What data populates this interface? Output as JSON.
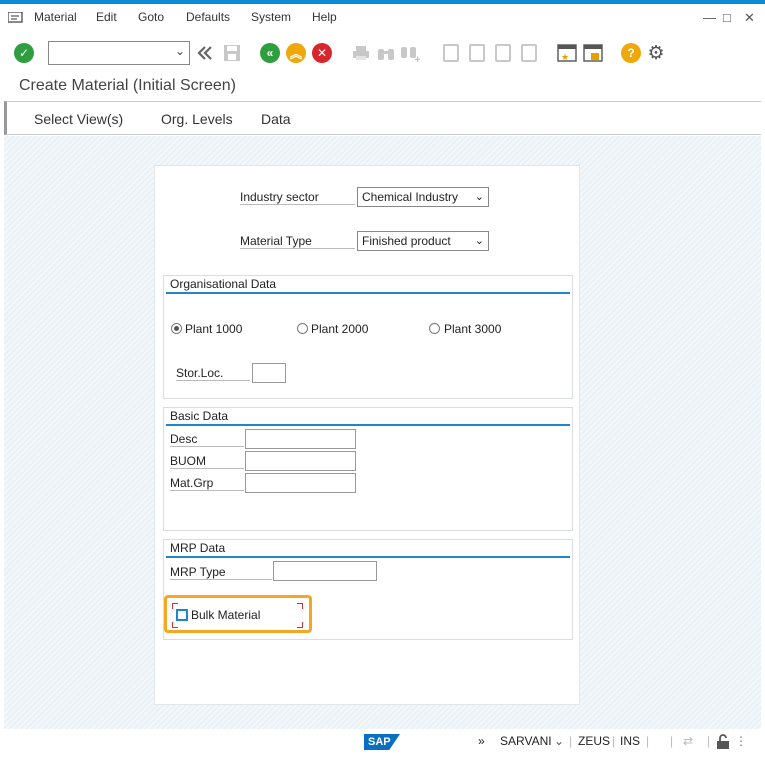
{
  "menu": {
    "items": [
      {
        "label": "Material"
      },
      {
        "label": "Edit"
      },
      {
        "label": "Goto"
      },
      {
        "label": "Defaults"
      },
      {
        "label": "System"
      },
      {
        "label": "Help"
      }
    ]
  },
  "window_controls": {
    "minimize": "—",
    "maximize": "□",
    "close": "✕"
  },
  "toolbar": {
    "command_field_value": "",
    "icons": [
      "enter-icon",
      "back-double-icon",
      "save-icon",
      "back-icon",
      "exit-icon",
      "cancel-icon",
      "print-icon",
      "find-icon",
      "find-next-icon",
      "first-page-icon",
      "previous-page-icon",
      "next-page-icon",
      "last-page-icon",
      "create-session-icon",
      "shortcut-icon",
      "help-icon",
      "settings-icon"
    ]
  },
  "page": {
    "title": "Create Material (Initial Screen)"
  },
  "tabs": [
    {
      "label": "Select View(s)"
    },
    {
      "label": "Org. Levels"
    },
    {
      "label": "Data"
    }
  ],
  "form": {
    "industry_sector": {
      "label": "Industry sector",
      "value": "Chemical Industry"
    },
    "material_type": {
      "label": "Material Type",
      "value": "Finished product"
    },
    "org_data": {
      "title": "Organisational Data",
      "plants": [
        {
          "label": "Plant 1000",
          "selected": true
        },
        {
          "label": "Plant 2000",
          "selected": false
        },
        {
          "label": "Plant 3000",
          "selected": false
        }
      ],
      "stor_loc_label": "Stor.Loc.",
      "stor_loc_value": ""
    },
    "basic_data": {
      "title": "Basic Data",
      "desc_label": "Desc",
      "buom_label": "BUOM",
      "matgrp_label": "Mat.Grp",
      "desc_value": "",
      "buom_value": "",
      "matgrp_value": ""
    },
    "mrp_data": {
      "title": "MRP Data",
      "mrp_type_label": "MRP Type",
      "mrp_type_value": "",
      "bulk_material_label": "Bulk Material",
      "bulk_material_checked": false
    }
  },
  "status": {
    "sap_logo": "SAP",
    "more": "»",
    "user": "SARVANI",
    "system": "ZEUS",
    "mode": "INS"
  },
  "colors": {
    "accent": "#1f86c8",
    "highlight": "#f5a623",
    "enter_green": "#2e9e3e",
    "exit_orange": "#f0a70a",
    "cancel_red": "#d9262c"
  }
}
